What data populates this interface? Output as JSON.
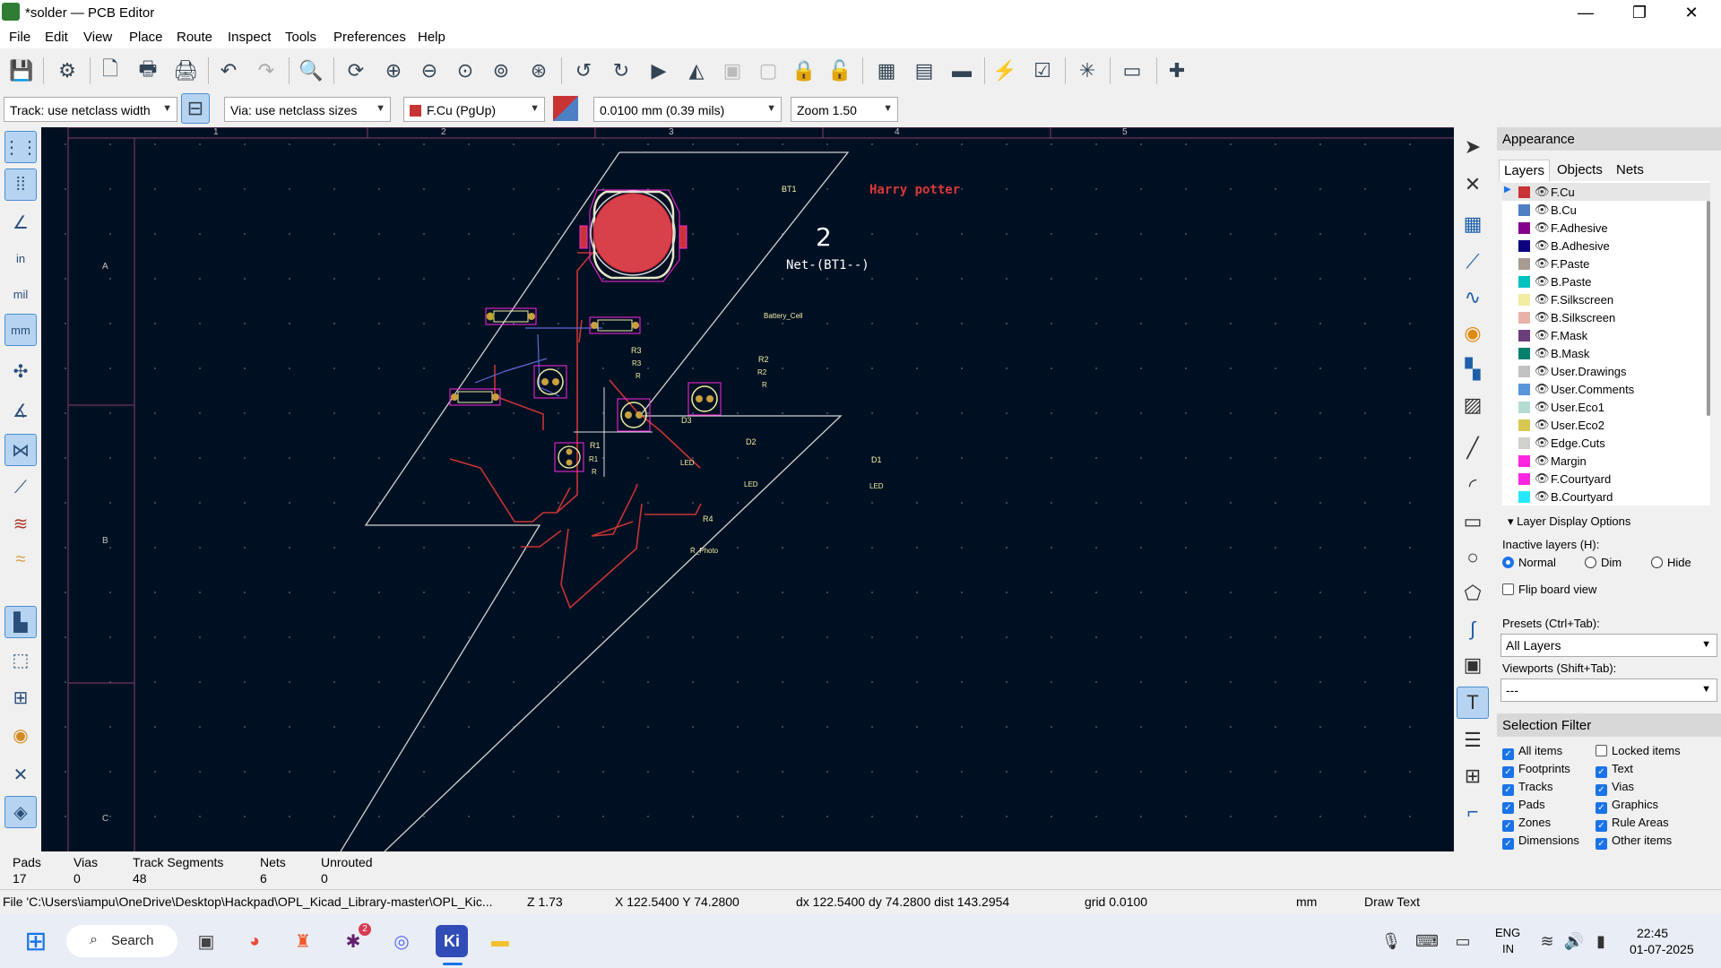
{
  "window": {
    "title": "*solder — PCB Editor",
    "minimize_glyph": "—",
    "maximize_glyph": "❐",
    "close_glyph": "✕"
  },
  "menu": [
    "File",
    "Edit",
    "View",
    "Place",
    "Route",
    "Inspect",
    "Tools",
    "Preferences",
    "Help"
  ],
  "toolbar2": {
    "track": "Track: use netclass width",
    "via": "Via: use netclass sizes",
    "layer": "F.Cu (PgUp)",
    "grid": "0.0100 mm (0.39 mils)",
    "zoom": "Zoom 1.50"
  },
  "left_toolbar": {
    "in_label": "in",
    "mil_label": "mil",
    "mm_label": "mm"
  },
  "canvas": {
    "ruler_top": [
      "1",
      "2",
      "3",
      "4",
      "5"
    ],
    "ruler_left": [
      "A",
      "B",
      "C"
    ],
    "silk_text": "Harry potter",
    "bt1": {
      "ref": "BT1",
      "pad_number": "2",
      "net": "Net-(BT1--)",
      "value": "Battery_Cell"
    },
    "r3": {
      "ref": "R3",
      "inner": "R3",
      "value": "R"
    },
    "r2": {
      "ref": "R2",
      "inner": "R2",
      "value": "R"
    },
    "r1": {
      "ref": "R1",
      "inner": "R1",
      "value": "R"
    },
    "d3": {
      "ref": "D3",
      "value": "LED"
    },
    "d2": {
      "ref": "D2",
      "value": "LED"
    },
    "d1": {
      "ref": "D1",
      "value": "LED"
    },
    "r4": {
      "ref": "R4",
      "value": "R_Photo"
    }
  },
  "appearance": {
    "title": "Appearance",
    "tabs": [
      "Layers",
      "Objects",
      "Nets"
    ],
    "layers": [
      {
        "name": "F.Cu",
        "color": "#c83434"
      },
      {
        "name": "B.Cu",
        "color": "#4d7fc4"
      },
      {
        "name": "F.Adhesive",
        "color": "#84008a"
      },
      {
        "name": "B.Adhesive",
        "color": "#0c007f"
      },
      {
        "name": "F.Paste",
        "color": "#a89c92"
      },
      {
        "name": "B.Paste",
        "color": "#00c2c2"
      },
      {
        "name": "F.Silkscreen",
        "color": "#f2eda1"
      },
      {
        "name": "B.Silkscreen",
        "color": "#e8b2a7"
      },
      {
        "name": "F.Mask",
        "color": "#6b3d7a"
      },
      {
        "name": "B.Mask",
        "color": "#02806e"
      },
      {
        "name": "User.Drawings",
        "color": "#c2c2c2"
      },
      {
        "name": "User.Comments",
        "color": "#5994dc"
      },
      {
        "name": "User.Eco1",
        "color": "#b4dbd2"
      },
      {
        "name": "User.Eco2",
        "color": "#d8c852"
      },
      {
        "name": "Edge.Cuts",
        "color": "#d0d2cd"
      },
      {
        "name": "Margin",
        "color": "#ff26e2"
      },
      {
        "name": "F.Courtyard",
        "color": "#ff26e2"
      },
      {
        "name": "B.Courtyard",
        "color": "#26e9ff"
      }
    ],
    "display_options": "Layer Display Options",
    "inactive_label": "Inactive layers (H):",
    "inactive_options": [
      "Normal",
      "Dim",
      "Hide"
    ],
    "flip_label": "Flip board view",
    "presets_label": "Presets (Ctrl+Tab):",
    "presets_value": "All Layers",
    "viewports_label": "Viewports (Shift+Tab):",
    "viewports_value": "---"
  },
  "selection_filter": {
    "title": "Selection Filter",
    "items": [
      {
        "label": "All items",
        "checked": true
      },
      {
        "label": "Locked items",
        "checked": false
      },
      {
        "label": "Footprints",
        "checked": true
      },
      {
        "label": "Text",
        "checked": true
      },
      {
        "label": "Tracks",
        "checked": true
      },
      {
        "label": "Vias",
        "checked": true
      },
      {
        "label": "Pads",
        "checked": true
      },
      {
        "label": "Graphics",
        "checked": true
      },
      {
        "label": "Zones",
        "checked": true
      },
      {
        "label": "Rule Areas",
        "checked": true
      },
      {
        "label": "Dimensions",
        "checked": true
      },
      {
        "label": "Other items",
        "checked": true
      }
    ]
  },
  "stats": [
    {
      "label": "Pads",
      "value": "17"
    },
    {
      "label": "Vias",
      "value": "0"
    },
    {
      "label": "Track Segments",
      "value": "48"
    },
    {
      "label": "Nets",
      "value": "6"
    },
    {
      "label": "Unrouted",
      "value": "0"
    }
  ],
  "status": {
    "file": "File 'C:\\Users\\iampu\\OneDrive\\Desktop\\Hackpad\\OPL_Kicad_Library-master\\OPL_Kic...",
    "z": "Z 1.73",
    "xy": "X 122.5400  Y 74.2800",
    "dxy": "dx 122.5400  dy 74.2800  dist 143.2954",
    "grid": "grid 0.0100",
    "units": "mm",
    "tool": "Draw Text"
  },
  "taskbar": {
    "search": "Search",
    "lang1": "ENG",
    "lang2": "IN",
    "time": "22:45",
    "date": "01-07-2025",
    "slack_badge": "2",
    "kicad_label": "Ki"
  }
}
